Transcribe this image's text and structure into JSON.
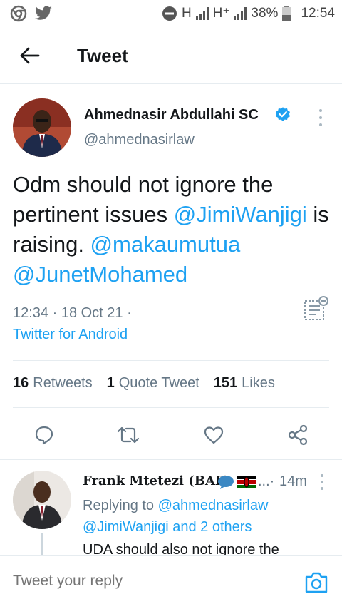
{
  "status_bar": {
    "network_1": "H",
    "network_2": "H⁺",
    "battery": "38%",
    "time": "12:54",
    "icons": [
      "chrome-icon",
      "twitter-icon",
      "dnd-icon",
      "signal-icon",
      "battery-icon"
    ]
  },
  "header": {
    "title": "Tweet"
  },
  "tweet": {
    "author_name": "Ahmednasir Abdullahi SC",
    "author_handle": "@ahmednasirlaw",
    "text_1": "Odm should not ignore the pertinent issues ",
    "mention_1": "@JimiWanjigi",
    "text_2": " is raising. ",
    "mention_2": "@makaumutua",
    "mention_3": "@JunetMohamed",
    "time": "12:34 · 18 Oct 21 ·",
    "source": "Twitter for Android",
    "stats": {
      "retweets_count": "16",
      "retweets_label": "Retweets",
      "quotes_count": "1",
      "quotes_label": "Quote Tweet",
      "likes_count": "151",
      "likes_label": "Likes"
    }
  },
  "reply": {
    "name": "Frank Mtetezi (BAF)",
    "dots": "...·",
    "time": "14m",
    "replying_prefix": "Replying to ",
    "replying_handle": "@ahmednasirlaw",
    "replying_rest": "@JimiWanjigi and 2 others",
    "text": "UDA should also not ignore the"
  },
  "compose": {
    "placeholder": "Tweet your reply"
  },
  "colors": {
    "accent": "#1da1f2",
    "text": "#14171a",
    "muted": "#657786",
    "divider": "#e6ecf0"
  }
}
